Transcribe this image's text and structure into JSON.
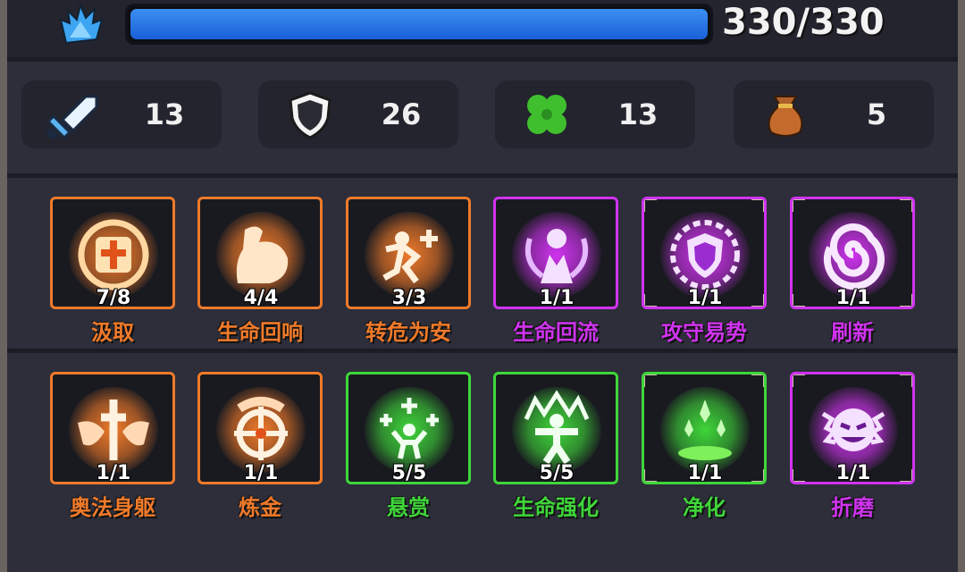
{
  "hp": {
    "current_text": "330/330",
    "fill_fraction": 1.0,
    "icon": "blue-flame-icon",
    "bar_color": "#2f7fe8"
  },
  "stats": [
    {
      "name": "attack",
      "icon": "sword-icon",
      "value": "13"
    },
    {
      "name": "defense",
      "icon": "shield-icon",
      "value": "26"
    },
    {
      "name": "luck",
      "icon": "clover-icon",
      "value": "13"
    },
    {
      "name": "gold",
      "icon": "money-bag-icon",
      "value": "5"
    }
  ],
  "skills_row1": [
    {
      "name": "汲取",
      "count": "7/8",
      "color": "#f07a2a",
      "tier": "orange",
      "icon": "cross-badge-icon"
    },
    {
      "name": "生命回响",
      "count": "4/4",
      "color": "#f07a2a",
      "tier": "orange",
      "icon": "muscle-arm-icon"
    },
    {
      "name": "转危为安",
      "count": "3/3",
      "color": "#f07a2a",
      "tier": "orange",
      "icon": "leaping-figure-icon"
    },
    {
      "name": "生命回流",
      "count": "1/1",
      "color": "#d033f0",
      "tier": "purple",
      "icon": "praying-figure-icon"
    },
    {
      "name": "攻守易势",
      "count": "1/1",
      "color": "#d033f0",
      "tier": "purple",
      "icon": "spiked-shield-icon"
    },
    {
      "name": "刷新",
      "count": "1/1",
      "color": "#d033f0",
      "tier": "purple",
      "icon": "swirl-icon"
    }
  ],
  "skills_row2": [
    {
      "name": "奥法身躯",
      "count": "1/1",
      "color": "#f07a2a",
      "tier": "orange",
      "icon": "winged-cross-icon"
    },
    {
      "name": "炼金",
      "count": "1/1",
      "color": "#f07a2a",
      "tier": "orange",
      "icon": "crosshair-icon"
    },
    {
      "name": "悬赏",
      "count": "5/5",
      "color": "#3fd63a",
      "tier": "green",
      "icon": "cheering-figure-icon"
    },
    {
      "name": "生命强化",
      "count": "5/5",
      "color": "#3fd63a",
      "tier": "green",
      "icon": "radiant-figure-icon"
    },
    {
      "name": "净化",
      "count": "1/1",
      "color": "#3fd63a",
      "tier": "green",
      "icon": "green-crystals-icon"
    },
    {
      "name": "折磨",
      "count": "1/1",
      "color": "#d033f0",
      "tier": "purple",
      "icon": "grinning-skull-icon"
    }
  ]
}
